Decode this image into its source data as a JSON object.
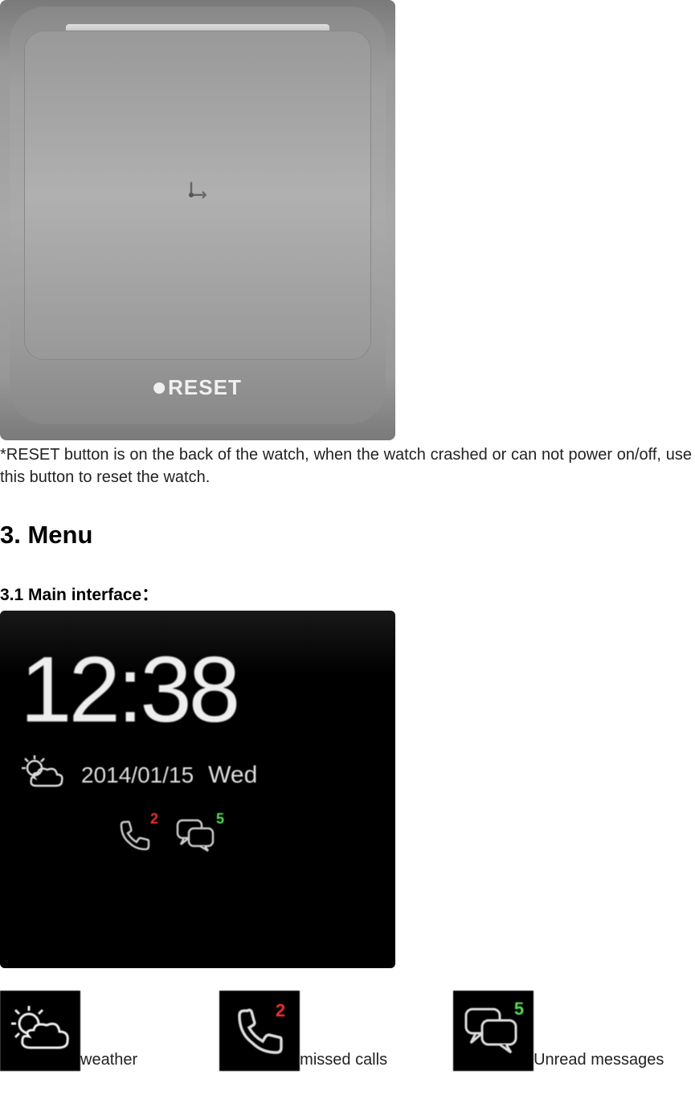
{
  "watch_back": {
    "reset_label": "RESET"
  },
  "reset_note": "*RESET button is on the back of the watch, when the watch crashed or can not power on/off, use this button to reset the watch.",
  "section3": {
    "heading": "3. Menu",
    "sub1": "3.1 Main interface："
  },
  "watch_front": {
    "time": "12:38",
    "date": "2014/01/15",
    "day": "Wed",
    "missed_calls_count": "2",
    "unread_messages_count": "5"
  },
  "legend": {
    "weather": "weather",
    "missed_calls": "missed calls",
    "unread_messages": "Unread messages",
    "missed_calls_badge": "2",
    "unread_messages_badge": "5"
  }
}
